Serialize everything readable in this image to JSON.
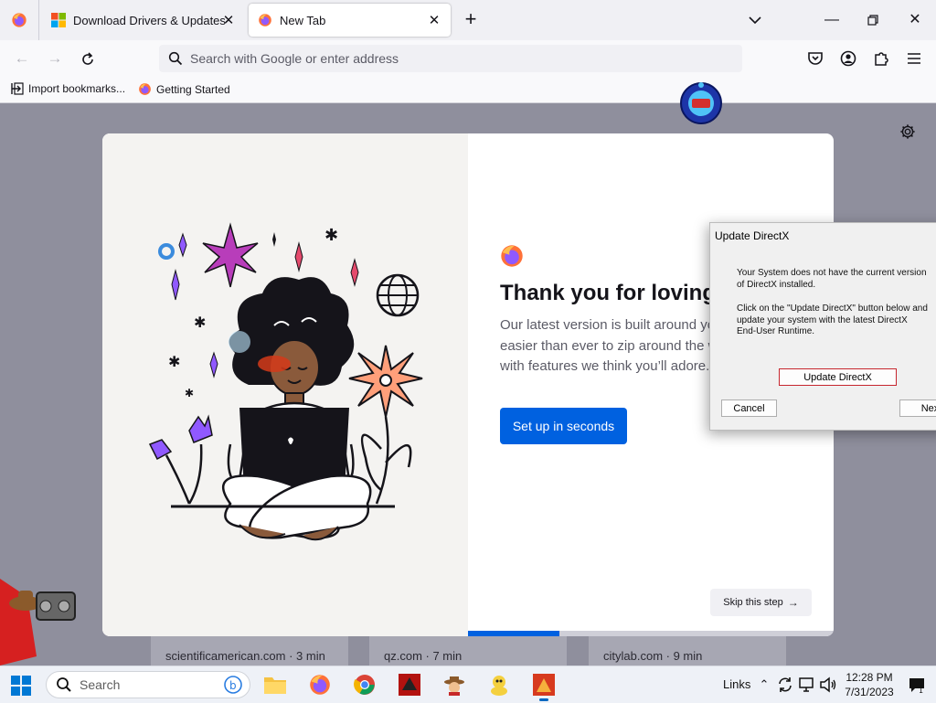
{
  "browser": {
    "tabs": [
      {
        "title": "Download Drivers & Updates for",
        "icon": "microsoft-logo-icon",
        "active": false
      },
      {
        "title": "New Tab",
        "icon": "firefox-logo-icon",
        "active": true
      }
    ],
    "urlbar": {
      "placeholder": "Search with Google or enter address"
    },
    "bookmarks": [
      {
        "label": "Import bookmarks...",
        "icon": "import-icon"
      },
      {
        "label": "Getting Started",
        "icon": "firefox-logo-icon"
      }
    ]
  },
  "onboarding": {
    "title": "Thank you for loving F",
    "body_lines": [
      "Our latest version is built around you,",
      "easier than ever to zip around the w",
      "with features we think you’ll adore."
    ],
    "primary_button": "Set up in seconds",
    "skip_button": "Skip this step",
    "progress": 0.25
  },
  "top_sites": [
    {
      "caption": "scientificamerican.com · 3 min"
    },
    {
      "caption": "qz.com · 7 min"
    },
    {
      "caption": "citylab.com · 9 min"
    }
  ],
  "directx_dialog": {
    "title": "Update DirectX",
    "message_lines_1": [
      "Your System does not have the current version",
      "of DirectX installed."
    ],
    "message_lines_2": [
      "Click on the \"Update DirectX\" button below and",
      "update your system with the latest DirectX",
      "End-User Runtime."
    ],
    "update_button": "Update DirectX",
    "cancel_button": "Cancel",
    "next_button": "Next"
  },
  "taskbar": {
    "search_label": "Search",
    "links_label": "Links",
    "time": "12:28 PM",
    "date": "7/31/2023"
  },
  "colors": {
    "accent": "#0061e0",
    "content_bg": "#8f8f9d",
    "danger_border": "#c6262e"
  }
}
